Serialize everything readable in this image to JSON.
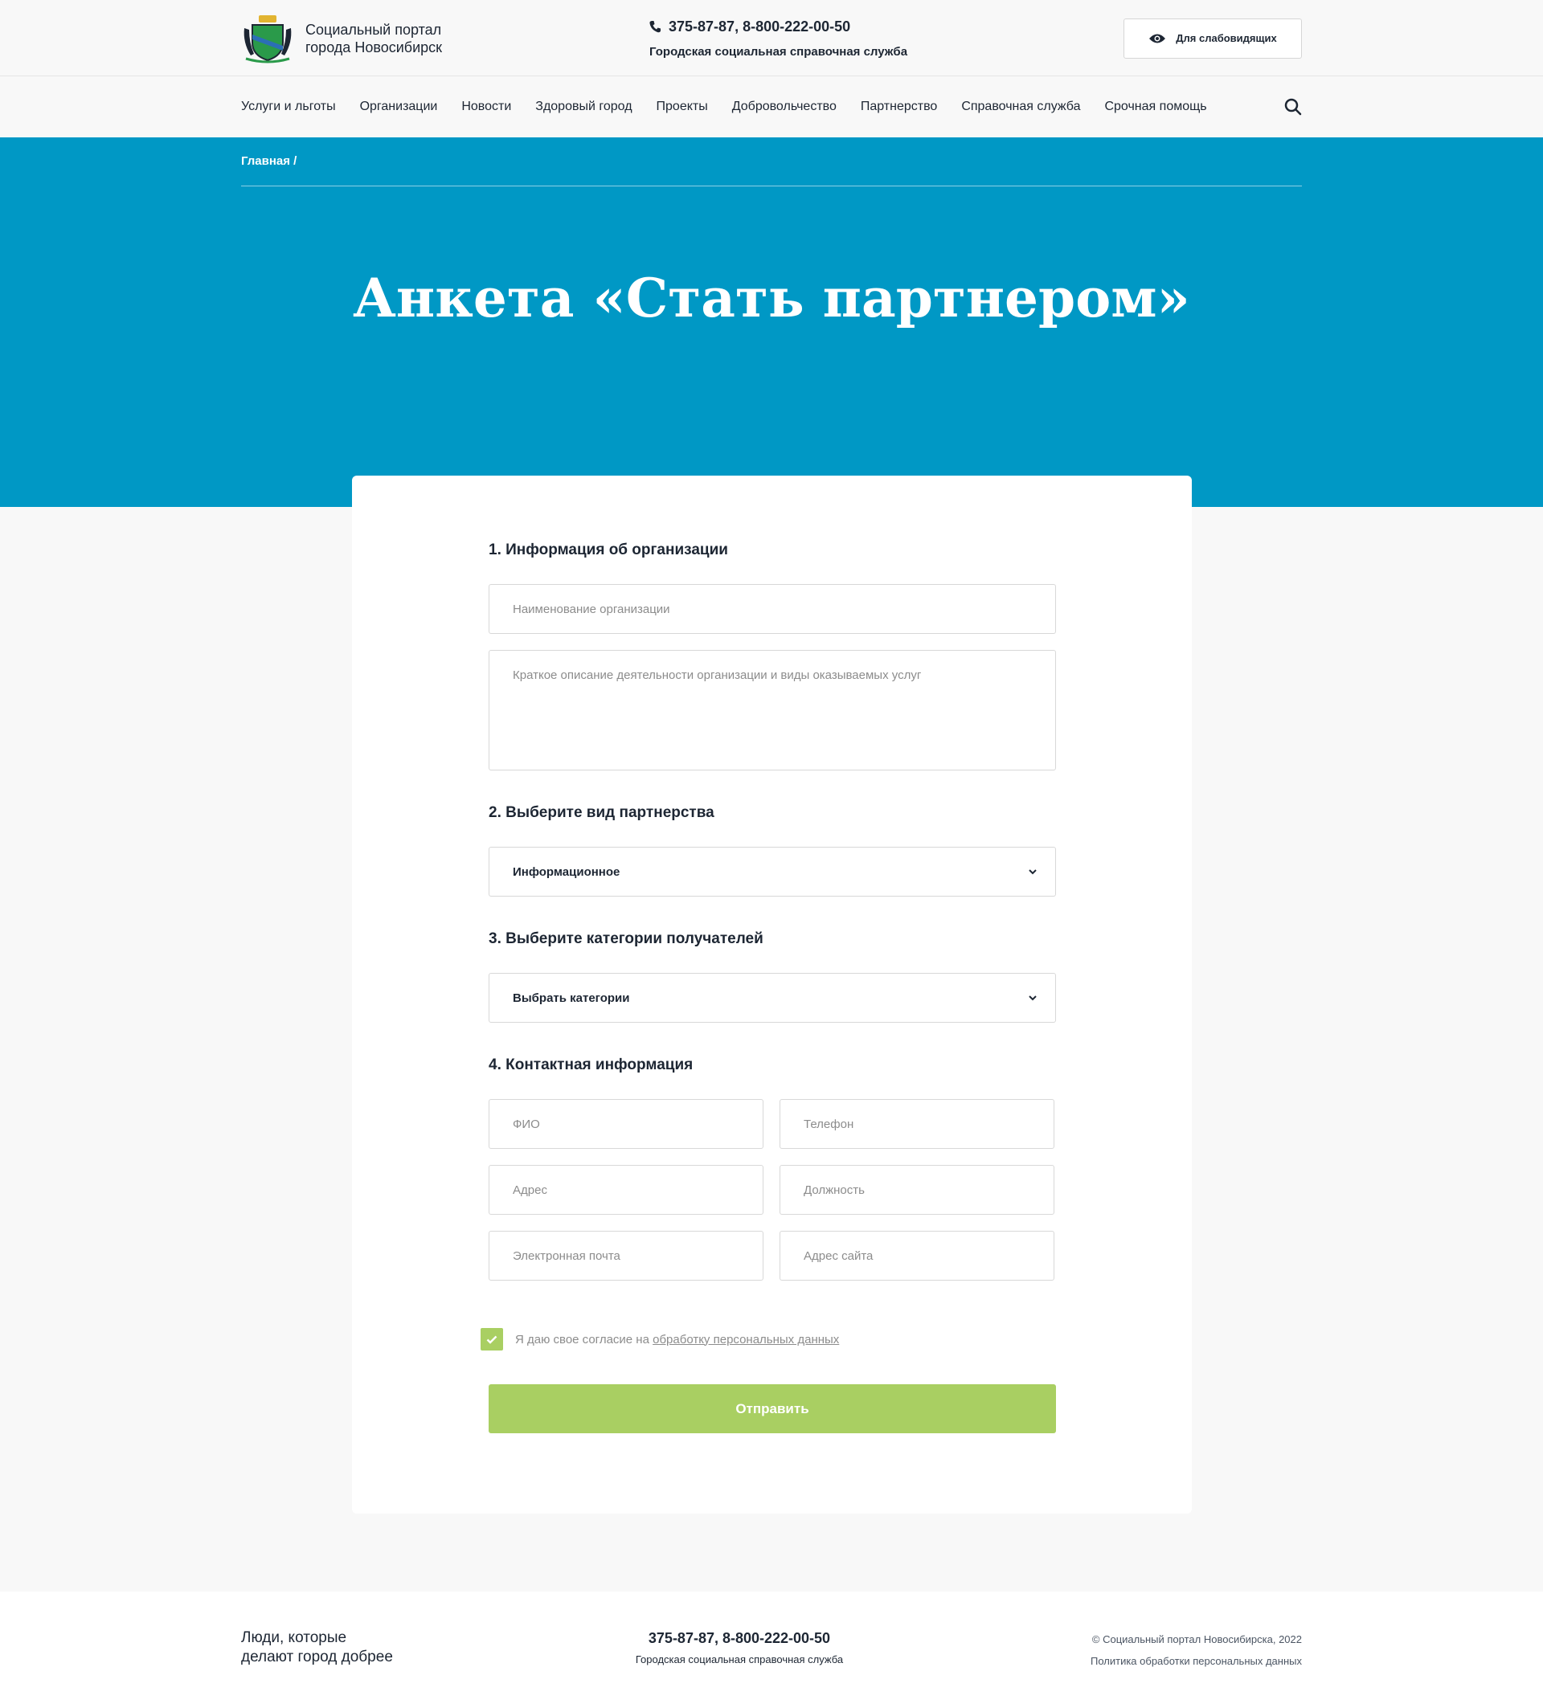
{
  "header": {
    "logo_text": "Социальный портал города Новосибирск",
    "phone": "375-87-87, 8-800-222-00-50",
    "service": "Городская социальная справочная служба",
    "accessibility_label": "Для слабовидящих"
  },
  "nav": {
    "items": [
      "Услуги и льготы",
      "Организации",
      "Новости",
      "Здоровый город",
      "Проекты",
      "Добровольчество",
      "Партнерство",
      "Справочная служба",
      "Срочная помощь"
    ]
  },
  "breadcrumb": "Главная /",
  "hero_title": "Анкета «Стать партнером»",
  "form": {
    "section1_title": "1. Информация об организации",
    "org_name_placeholder": "Наименование организации",
    "description_placeholder": "Краткое описание деятельности организации и виды оказываемых услуг",
    "section2_title": "2. Выберите вид партнерства",
    "partnership_value": "Информационное",
    "section3_title": "3. Выберите категории получателей",
    "categories_value": "Выбрать категории",
    "section4_title": "4. Контактная информация",
    "fio_placeholder": "ФИО",
    "phone_placeholder": "Телефон",
    "address_placeholder": "Адрес",
    "position_placeholder": "Должность",
    "email_placeholder": "Электронная почта",
    "website_placeholder": "Адрес сайта",
    "consent_text": "Я даю свое согласие на",
    "consent_link": "обработку персональных данных",
    "consent_checked": true,
    "submit_label": "Отправить"
  },
  "footer": {
    "slogan_line1": "Люди, которые",
    "slogan_line2": "делают город добрее",
    "phone": "375-87-87, 8-800-222-00-50",
    "service": "Городская социальная справочная служба",
    "copyright": "© Социальный портал Новосибирска, 2022",
    "policy_link": "Политика обработки персональных данных"
  },
  "colors": {
    "hero_blue": "#0098c5",
    "accent_green": "#a9cf62",
    "text_dark": "#1d2633"
  }
}
